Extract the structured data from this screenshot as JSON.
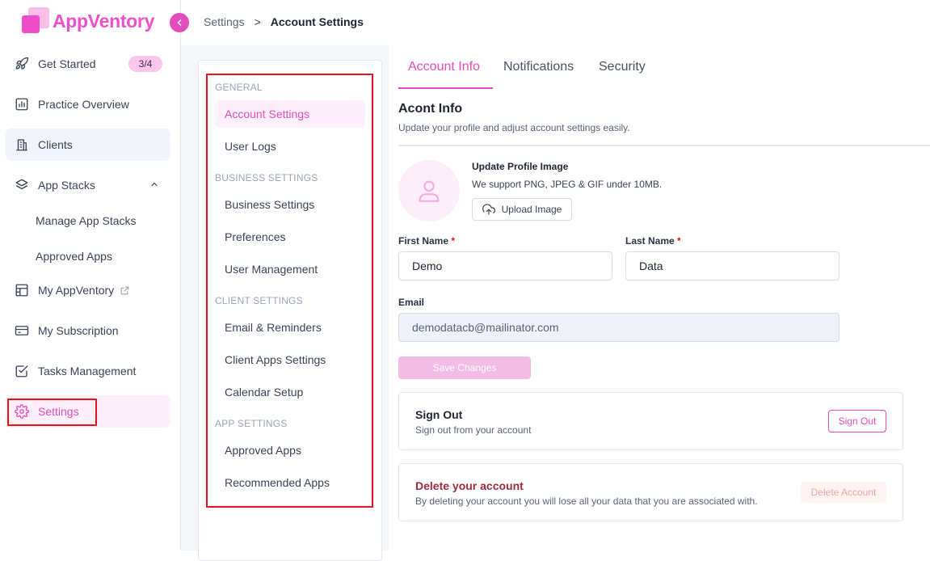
{
  "app": {
    "name": "AppVentory"
  },
  "breadcrumb": {
    "parent": "Settings",
    "separator": ">",
    "current": "Account Settings"
  },
  "sidebar": {
    "items": [
      {
        "label": "Get Started",
        "icon": "rocket-icon",
        "badge": "3/4"
      },
      {
        "label": "Practice Overview",
        "icon": "chart-icon"
      },
      {
        "label": "Clients",
        "icon": "building-icon"
      },
      {
        "label": "App Stacks",
        "icon": "layers-icon"
      },
      {
        "label": "Manage App Stacks"
      },
      {
        "label": "Approved Apps"
      },
      {
        "label": "My AppVentory",
        "icon": "store-icon"
      },
      {
        "label": "My Subscription",
        "icon": "card-icon"
      },
      {
        "label": "Tasks Management",
        "icon": "checkbox-icon"
      },
      {
        "label": "Settings",
        "icon": "gear-icon"
      }
    ]
  },
  "submenu": {
    "groups": [
      {
        "title": "GENERAL",
        "items": [
          "Account Settings",
          "User Logs"
        ]
      },
      {
        "title": "BUSINESS SETTINGS",
        "items": [
          "Business Settings",
          "Preferences",
          "User Management"
        ]
      },
      {
        "title": "CLIENT SETTINGS",
        "items": [
          "Email & Reminders",
          "Client Apps Settings",
          "Calendar Setup"
        ]
      },
      {
        "title": "APP SETTINGS",
        "items": [
          "Approved Apps",
          "Recommended Apps"
        ]
      }
    ]
  },
  "tabs": [
    "Account Info",
    "Notifications",
    "Security"
  ],
  "account": {
    "title": "Acont Info",
    "subtitle": "Update your profile and adjust account settings easily.",
    "profile_image_title": "Update Profile Image",
    "profile_image_hint": "We support PNG, JPEG & GIF under 10MB.",
    "upload_label": "Upload Image",
    "first_name_label": "First Name",
    "last_name_label": "Last Name",
    "required_mark": "*",
    "first_name": "Demo",
    "last_name": "Data",
    "email_label": "Email",
    "email": "demodatacb@mailinator.com",
    "save_label": "Save Changes"
  },
  "signout": {
    "title": "Sign Out",
    "subtitle": "Sign out from your account",
    "button": "Sign Out"
  },
  "delete": {
    "title": "Delete your account",
    "subtitle": "By deleting your account you will lose all your data that you are associated with.",
    "button": "Delete Account"
  },
  "colors": {
    "brand": "#e14cbe",
    "highlight_border": "#e3141e",
    "danger_text": "#9b2b3a"
  }
}
